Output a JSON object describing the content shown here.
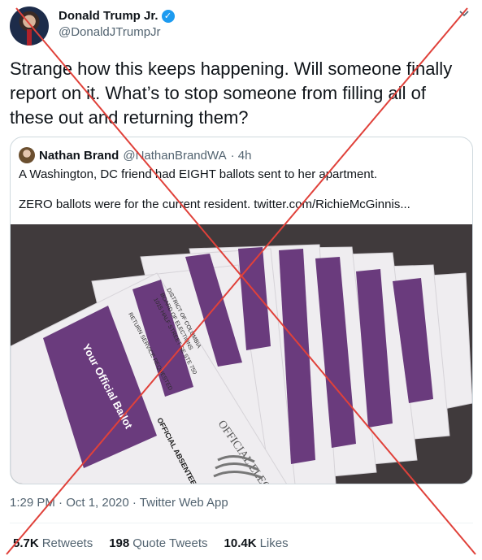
{
  "author": {
    "name": "Donald Trump Jr.",
    "handle": "@DonaldJTrumpJr",
    "verified_icon": "verified-badge-icon"
  },
  "tweet": {
    "text": "Strange how this keeps happening. Will someone finally report on it. What’s to stop someone from filling all of these out and returning them?"
  },
  "quote": {
    "name": "Nathan Brand",
    "handle": "@NathanBrandWA",
    "time": "· 4h",
    "line1": "A Washington, DC friend had EIGHT ballots sent to her apartment.",
    "line2": "ZERO ballots were for the current resident.  twitter.com/RichieMcGinnis..."
  },
  "image": {
    "ballot_title": "Your Official Ballot",
    "district": "DISTRICT OF COLUMBIA",
    "board": "BOARD OF ELECTIONS",
    "address": "1015 HALF STREET SE STE 750",
    "return": "RETURN SERVICE REQUESTED",
    "official_absentee": "OFFICIAL ABSENTEE",
    "election_stamp": "OFFICIAL ELECTION"
  },
  "meta": {
    "timestamp": "1:29 PM · Oct 1, 2020 · Twitter Web App"
  },
  "stats": {
    "retweets_num": "5.7K",
    "retweets_label": "Retweets",
    "quotes_num": "198",
    "quotes_label": "Quote Tweets",
    "likes_num": "10.4K",
    "likes_label": "Likes"
  },
  "colors": {
    "cross": "#e0413a",
    "envelope_purple": "#6a3b7d",
    "accent_blue": "#1d9bf0"
  }
}
